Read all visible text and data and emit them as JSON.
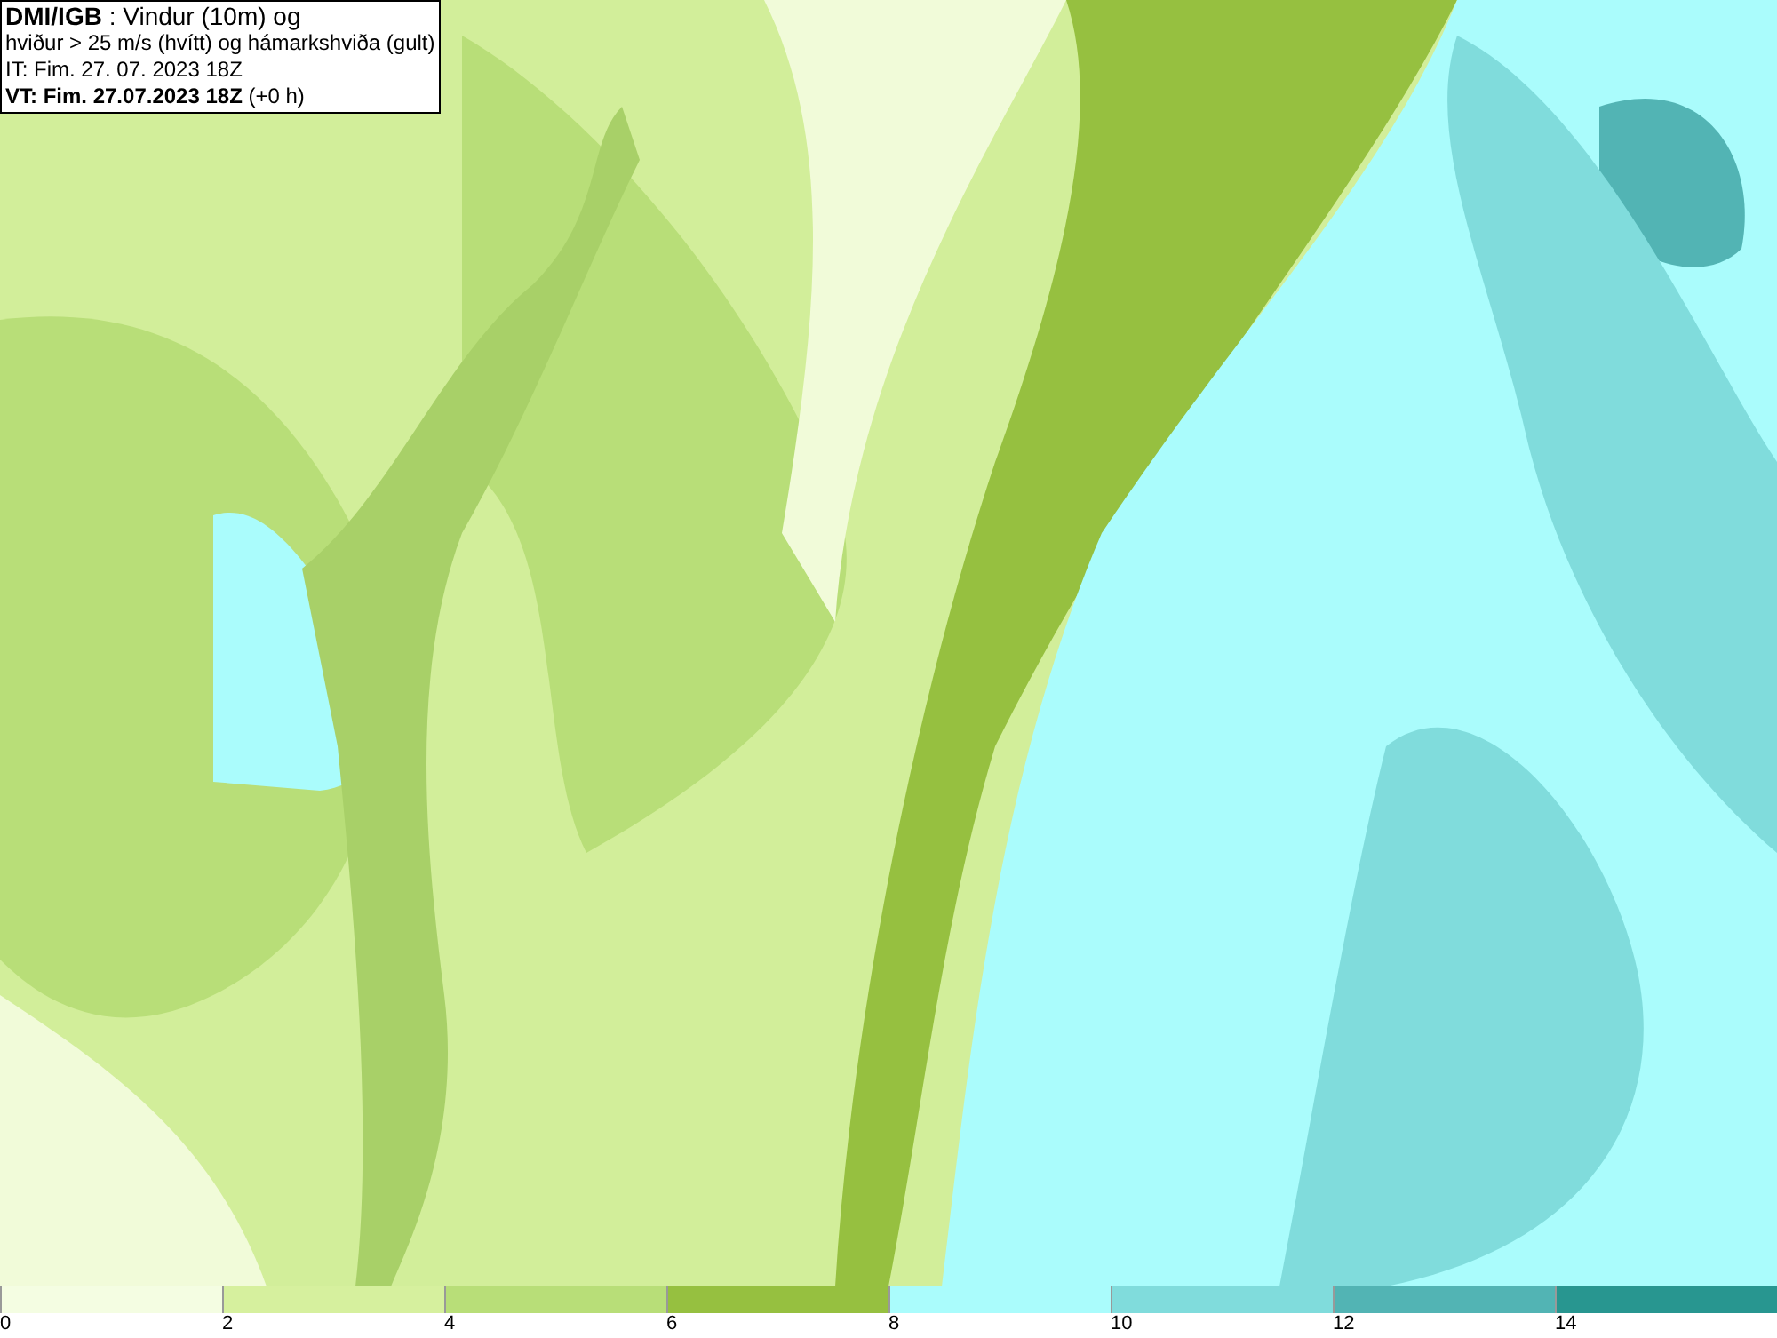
{
  "info_box": {
    "lines": [
      "**DMI/IGB** : Vindur (10m) og",
      "hviður > 25 m/s (hvítt) og hámarkshviða (gult)",
      "IT: Fim. 27. 07. 2023 18Z",
      "**VT: Fim. 27.07.2023 18Z** (+0 h)"
    ]
  },
  "legend": {
    "bins": [
      {
        "label": "0",
        "color": "#f4fde2"
      },
      {
        "label": "2",
        "color": "#d6f09e"
      },
      {
        "label": "4",
        "color": "#b8de78"
      },
      {
        "label": "6",
        "color": "#96c040"
      },
      {
        "label": "8",
        "color": "#aafcfc"
      },
      {
        "label": "10",
        "color": "#80dcdc"
      },
      {
        "label": "12",
        "color": "#52b4b4"
      },
      {
        "label": "14",
        "color": "#289690"
      }
    ]
  }
}
